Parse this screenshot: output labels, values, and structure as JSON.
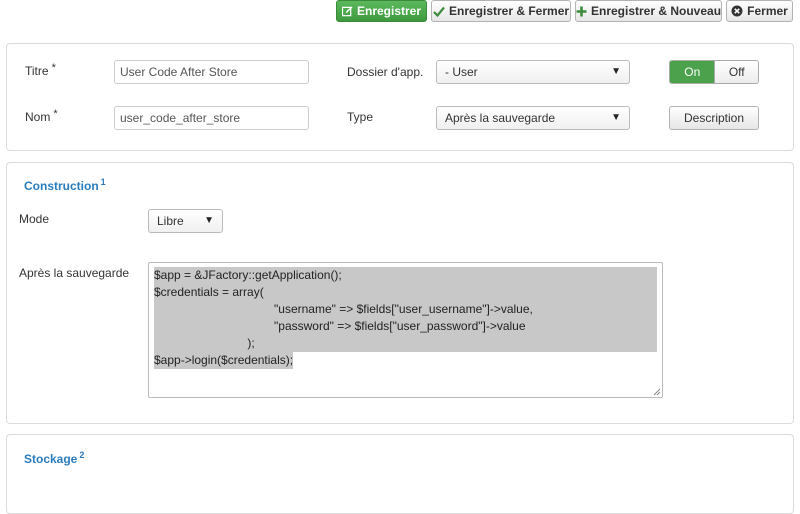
{
  "toolbar": {
    "save_label": "Enregistrer",
    "save_close_label": "Enregistrer & Fermer",
    "save_new_label": "Enregistrer & Nouveau",
    "close_label": "Fermer"
  },
  "form": {
    "title_label": "Titre",
    "title_value": "User Code After Store",
    "name_label": "Nom",
    "name_value": "user_code_after_store",
    "required_marker": "*",
    "folder_label": "Dossier d'app.",
    "folder_value": "- User",
    "type_label": "Type",
    "type_value": "Après la sauvegarde",
    "toggle_on": "On",
    "toggle_off": "Off",
    "description_label": "Description"
  },
  "construction": {
    "title": "Construction",
    "footnote": "1",
    "mode_label": "Mode",
    "mode_value": "Libre",
    "after_save_label": "Après la sauvegarde",
    "code_lines": [
      "$app = &JFactory::getApplication();",
      "$credentials = array(",
      "                                    \"username\" => $fields[\"user_username\"]->value,",
      "                                    \"password\" => $fields[\"user_password\"]->value",
      "                            );",
      "$app->login($credentials);"
    ]
  },
  "storage": {
    "title": "Stockage",
    "footnote": "2"
  },
  "colors": {
    "primary_green": "#4ca24c",
    "section_blue": "#2b7cbd"
  }
}
